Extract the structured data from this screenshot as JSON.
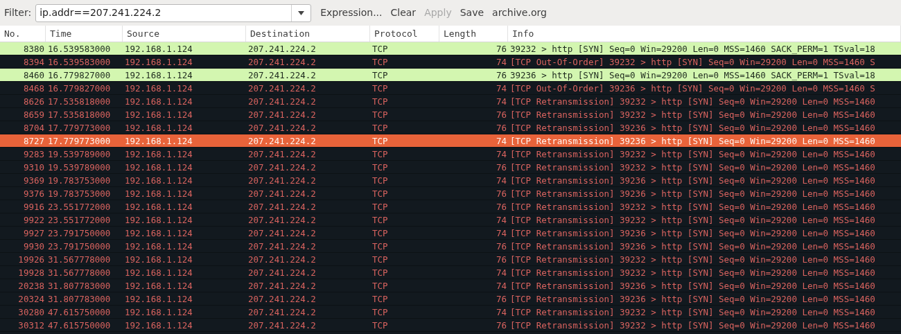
{
  "toolbar": {
    "filter_label": "Filter:",
    "filter_value": "ip.addr==207.241.224.2",
    "buttons": [
      {
        "label": "Expression...",
        "disabled": false
      },
      {
        "label": "Clear",
        "disabled": false
      },
      {
        "label": "Apply",
        "disabled": true
      },
      {
        "label": "Save",
        "disabled": false
      },
      {
        "label": "archive.org",
        "disabled": false
      }
    ]
  },
  "table": {
    "columns": [
      "No.",
      "Time",
      "Source",
      "Destination",
      "Protocol",
      "Length",
      "Info"
    ],
    "rows": [
      {
        "kind": "syn",
        "selected": false,
        "cells": [
          "8380",
          "16.539583000",
          "192.168.1.124",
          "207.241.224.2",
          "TCP",
          "76",
          "39232 > http [SYN] Seq=0 Win=29200 Len=0 MSS=1460 SACK_PERM=1 TSval=18"
        ]
      },
      {
        "kind": "bad",
        "selected": false,
        "cells": [
          "8394",
          "16.539583000",
          "192.168.1.124",
          "207.241.224.2",
          "TCP",
          "74",
          "[TCP Out-Of-Order] 39232 > http [SYN] Seq=0 Win=29200 Len=0 MSS=1460 S"
        ]
      },
      {
        "kind": "syn",
        "selected": false,
        "cells": [
          "8460",
          "16.779827000",
          "192.168.1.124",
          "207.241.224.2",
          "TCP",
          "76",
          "39236 > http [SYN] Seq=0 Win=29200 Len=0 MSS=1460 SACK_PERM=1 TSval=18"
        ]
      },
      {
        "kind": "bad",
        "selected": false,
        "cells": [
          "8468",
          "16.779827000",
          "192.168.1.124",
          "207.241.224.2",
          "TCP",
          "74",
          "[TCP Out-Of-Order] 39236 > http [SYN] Seq=0 Win=29200 Len=0 MSS=1460 S"
        ]
      },
      {
        "kind": "bad",
        "selected": false,
        "cells": [
          "8626",
          "17.535818000",
          "192.168.1.124",
          "207.241.224.2",
          "TCP",
          "74",
          "[TCP Retransmission] 39232 > http [SYN] Seq=0 Win=29200 Len=0 MSS=1460"
        ]
      },
      {
        "kind": "bad",
        "selected": false,
        "cells": [
          "8659",
          "17.535818000",
          "192.168.1.124",
          "207.241.224.2",
          "TCP",
          "76",
          "[TCP Retransmission] 39232 > http [SYN] Seq=0 Win=29200 Len=0 MSS=1460"
        ]
      },
      {
        "kind": "bad",
        "selected": false,
        "cells": [
          "8704",
          "17.779773000",
          "192.168.1.124",
          "207.241.224.2",
          "TCP",
          "76",
          "[TCP Retransmission] 39236 > http [SYN] Seq=0 Win=29200 Len=0 MSS=1460"
        ]
      },
      {
        "kind": "bad",
        "selected": true,
        "cells": [
          "8727",
          "17.779773000",
          "192.168.1.124",
          "207.241.224.2",
          "TCP",
          "74",
          "[TCP Retransmission] 39236 > http [SYN] Seq=0 Win=29200 Len=0 MSS=1460"
        ]
      },
      {
        "kind": "bad",
        "selected": false,
        "cells": [
          "9283",
          "19.539789000",
          "192.168.1.124",
          "207.241.224.2",
          "TCP",
          "74",
          "[TCP Retransmission] 39232 > http [SYN] Seq=0 Win=29200 Len=0 MSS=1460"
        ]
      },
      {
        "kind": "bad",
        "selected": false,
        "cells": [
          "9310",
          "19.539789000",
          "192.168.1.124",
          "207.241.224.2",
          "TCP",
          "76",
          "[TCP Retransmission] 39232 > http [SYN] Seq=0 Win=29200 Len=0 MSS=1460"
        ]
      },
      {
        "kind": "bad",
        "selected": false,
        "cells": [
          "9369",
          "19.783753000",
          "192.168.1.124",
          "207.241.224.2",
          "TCP",
          "74",
          "[TCP Retransmission] 39236 > http [SYN] Seq=0 Win=29200 Len=0 MSS=1460"
        ]
      },
      {
        "kind": "bad",
        "selected": false,
        "cells": [
          "9376",
          "19.783753000",
          "192.168.1.124",
          "207.241.224.2",
          "TCP",
          "76",
          "[TCP Retransmission] 39236 > http [SYN] Seq=0 Win=29200 Len=0 MSS=1460"
        ]
      },
      {
        "kind": "bad",
        "selected": false,
        "cells": [
          "9916",
          "23.551772000",
          "192.168.1.124",
          "207.241.224.2",
          "TCP",
          "76",
          "[TCP Retransmission] 39232 > http [SYN] Seq=0 Win=29200 Len=0 MSS=1460"
        ]
      },
      {
        "kind": "bad",
        "selected": false,
        "cells": [
          "9922",
          "23.551772000",
          "192.168.1.124",
          "207.241.224.2",
          "TCP",
          "74",
          "[TCP Retransmission] 39232 > http [SYN] Seq=0 Win=29200 Len=0 MSS=1460"
        ]
      },
      {
        "kind": "bad",
        "selected": false,
        "cells": [
          "9927",
          "23.791750000",
          "192.168.1.124",
          "207.241.224.2",
          "TCP",
          "74",
          "[TCP Retransmission] 39236 > http [SYN] Seq=0 Win=29200 Len=0 MSS=1460"
        ]
      },
      {
        "kind": "bad",
        "selected": false,
        "cells": [
          "9930",
          "23.791750000",
          "192.168.1.124",
          "207.241.224.2",
          "TCP",
          "76",
          "[TCP Retransmission] 39236 > http [SYN] Seq=0 Win=29200 Len=0 MSS=1460"
        ]
      },
      {
        "kind": "bad",
        "selected": false,
        "cells": [
          "19926",
          "31.567778000",
          "192.168.1.124",
          "207.241.224.2",
          "TCP",
          "76",
          "[TCP Retransmission] 39232 > http [SYN] Seq=0 Win=29200 Len=0 MSS=1460"
        ]
      },
      {
        "kind": "bad",
        "selected": false,
        "cells": [
          "19928",
          "31.567778000",
          "192.168.1.124",
          "207.241.224.2",
          "TCP",
          "74",
          "[TCP Retransmission] 39232 > http [SYN] Seq=0 Win=29200 Len=0 MSS=1460"
        ]
      },
      {
        "kind": "bad",
        "selected": false,
        "cells": [
          "20238",
          "31.807783000",
          "192.168.1.124",
          "207.241.224.2",
          "TCP",
          "74",
          "[TCP Retransmission] 39236 > http [SYN] Seq=0 Win=29200 Len=0 MSS=1460"
        ]
      },
      {
        "kind": "bad",
        "selected": false,
        "cells": [
          "20324",
          "31.807783000",
          "192.168.1.124",
          "207.241.224.2",
          "TCP",
          "76",
          "[TCP Retransmission] 39236 > http [SYN] Seq=0 Win=29200 Len=0 MSS=1460"
        ]
      },
      {
        "kind": "bad",
        "selected": false,
        "cells": [
          "30280",
          "47.615750000",
          "192.168.1.124",
          "207.241.224.2",
          "TCP",
          "74",
          "[TCP Retransmission] 39232 > http [SYN] Seq=0 Win=29200 Len=0 MSS=1460"
        ]
      },
      {
        "kind": "bad",
        "selected": false,
        "cells": [
          "30312",
          "47.615750000",
          "192.168.1.124",
          "207.241.224.2",
          "TCP",
          "76",
          "[TCP Retransmission] 39232 > http [SYN] Seq=0 Win=29200 Len=0 MSS=1460"
        ]
      }
    ]
  }
}
